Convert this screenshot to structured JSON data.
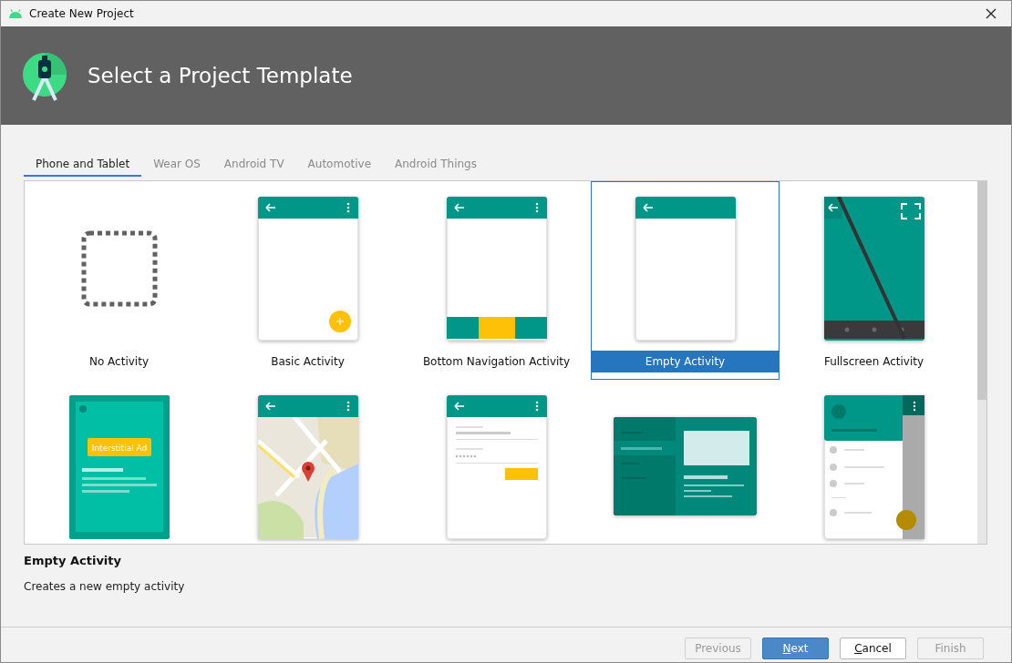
{
  "window": {
    "title": "Create New Project"
  },
  "header": {
    "title": "Select a Project Template"
  },
  "tabs": [
    {
      "label": "Phone and Tablet",
      "selected": true
    },
    {
      "label": "Wear OS",
      "selected": false
    },
    {
      "label": "Android TV",
      "selected": false
    },
    {
      "label": "Automotive",
      "selected": false
    },
    {
      "label": "Android Things",
      "selected": false
    }
  ],
  "templates": [
    {
      "kind": "none",
      "label": "No Activity",
      "selected": false
    },
    {
      "kind": "basic",
      "label": "Basic Activity",
      "selected": false
    },
    {
      "kind": "bottom_nav",
      "label": "Bottom Navigation Activity",
      "selected": false
    },
    {
      "kind": "empty",
      "label": "Empty Activity",
      "selected": true
    },
    {
      "kind": "fullscreen",
      "label": "Fullscreen Activity",
      "selected": false
    },
    {
      "kind": "ad",
      "thumbnail_text": "Interstitial Ad",
      "selected": false
    },
    {
      "kind": "maps",
      "selected": false
    },
    {
      "kind": "login",
      "selected": false
    },
    {
      "kind": "master_detail",
      "selected": false
    },
    {
      "kind": "drawer",
      "selected": false
    }
  ],
  "description": {
    "title": "Empty Activity",
    "text": "Creates a new empty activity"
  },
  "buttons": [
    {
      "label": "Previous",
      "disabled": true,
      "default": false,
      "mnemonic_underline": false
    },
    {
      "label": "Next",
      "disabled": false,
      "default": true,
      "mnemonic_underline": true
    },
    {
      "label": "Cancel",
      "disabled": false,
      "default": false,
      "mnemonic_underline": true
    },
    {
      "label": "Finish",
      "disabled": true,
      "default": false,
      "mnemonic_underline": false
    }
  ]
}
